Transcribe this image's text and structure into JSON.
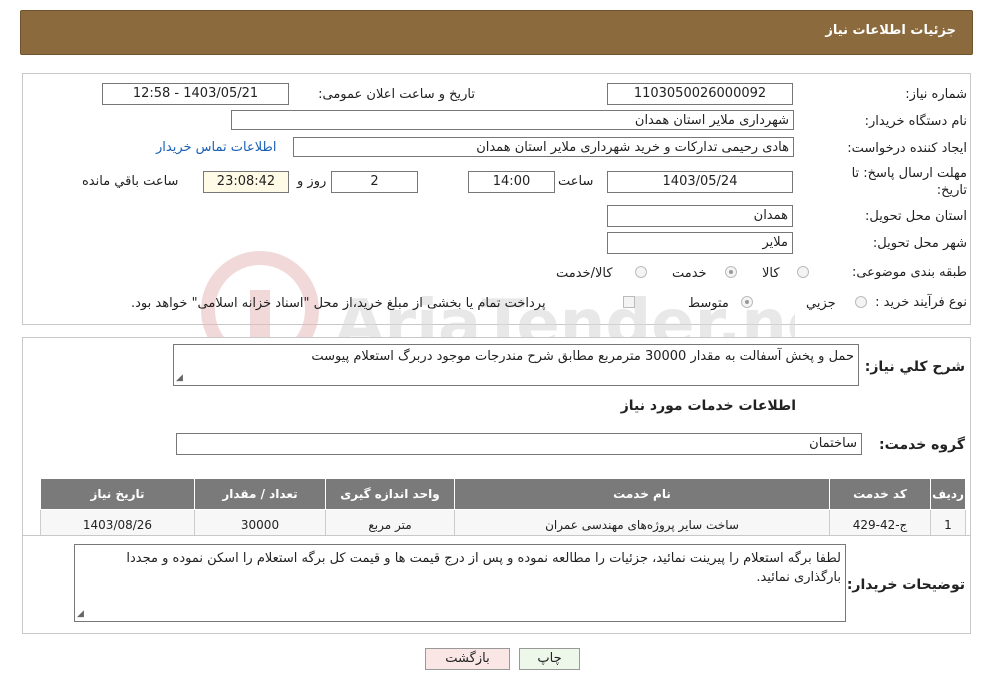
{
  "header": {
    "title": "جزئیات اطلاعات نیاز"
  },
  "form": {
    "need_number_label": "شماره نیاز:",
    "need_number": "1103050026000092",
    "announce_label": "تاریخ و ساعت اعلان عمومی:",
    "announce_value": "1403/05/21 - 12:58",
    "buyer_org_label": "نام دستگاه خریدار:",
    "buyer_org": "شهرداری ملایر استان همدان",
    "creator_label": "ایجاد کننده درخواست:",
    "creator": "هادی رحیمی تدارکات و خرید شهرداری ملایر استان همدان",
    "contact_link": "اطلاعات تماس خریدار",
    "deadline_label": "مهلت ارسال پاسخ: تا تاریخ:",
    "deadline_date": "1403/05/24",
    "time_label": "ساعت",
    "deadline_time": "14:00",
    "days_value": "2",
    "days_label": "روز و",
    "remaining_time": "23:08:42",
    "remaining_label": "ساعت باقي مانده",
    "province_label": "استان محل تحویل:",
    "province": "همدان",
    "city_label": "شهر محل تحویل:",
    "city": "ملایر",
    "category_label": "طبقه بندی موضوعی:",
    "category_options": [
      "کالا",
      "خدمت",
      "کالا/خدمت"
    ],
    "process_label": "نوع فرآیند خرید :",
    "process_options": [
      "جزیي",
      "متوسط"
    ],
    "payment_note": "پرداخت تمام یا بخشی از مبلغ خرید،از محل \"اسناد خزانه اسلامی\" خواهد بود."
  },
  "description": {
    "label": "شرح کلي نياز:",
    "text": "حمل و پخش آسفالت به مقدار 30000 مترمربع مطابق شرح مندرجات موجود دربرگ استعلام پیوست"
  },
  "services": {
    "title": "اطلاعات خدمات مورد نياز",
    "group_label": "گروه خدمت:",
    "group_value": "ساختمان",
    "columns": [
      "ردیف",
      "کد خدمت",
      "نام خدمت",
      "واحد اندازه گیری",
      "تعداد / مقدار",
      "تاریخ نیاز"
    ],
    "rows": [
      [
        "1",
        "ج-42-429",
        "ساخت سایر پروژه‌های مهندسی عمران",
        "متر مربع",
        "30000",
        "1403/08/26"
      ]
    ]
  },
  "buyer_notes": {
    "label": "توضیحات خریدار:",
    "text": "لطفا برگه استعلام را پیرینت نمائید، جزئیات را مطالعه نموده و پس از درج قیمت ها و قیمت کل برگه استعلام را اسکن نموده و مجددا بارگذاری نمائید."
  },
  "buttons": {
    "print": "چاپ",
    "back": "بازگشت"
  },
  "watermark": "AriaTender.net"
}
